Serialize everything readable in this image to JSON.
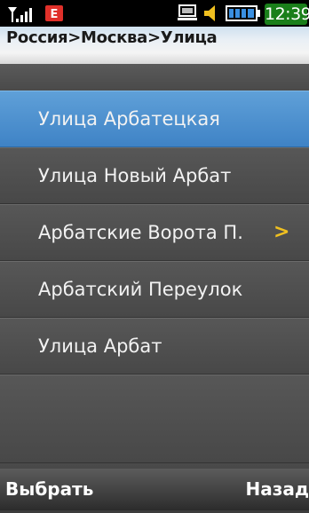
{
  "status_bar": {
    "time": "12:39",
    "icons": [
      "signal-icon",
      "envelope-icon",
      "computer-icon",
      "speaker-icon",
      "battery-icon"
    ],
    "clock_bg": "#1a7f1a",
    "envelope_color": "#e0302a",
    "speaker_color": "#f0c020"
  },
  "header": {
    "breadcrumb": "Россия>Москва>Улица"
  },
  "list": {
    "items": [
      {
        "label": "Улица Арбатецкая",
        "selected": true
      },
      {
        "label": "Улица Новый Арбат",
        "selected": false
      },
      {
        "label": "Арбатские Ворота П.",
        "selected": false,
        "chevron": ">"
      },
      {
        "label": "Арбатский Переулок",
        "selected": false
      },
      {
        "label": "Улица Арбат",
        "selected": false
      }
    ],
    "selected_color": "#4a8fd0",
    "chevron_color": "#f0c020"
  },
  "softkeys": {
    "left_label": "Выбрать",
    "right_label": "Назад"
  }
}
